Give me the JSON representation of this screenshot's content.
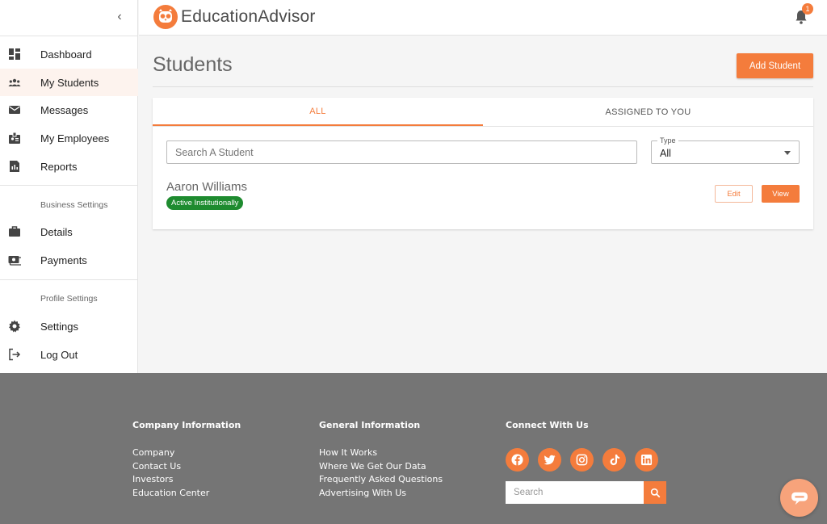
{
  "brand": {
    "name": "EducationAdvisor",
    "accent": "#f47c3c"
  },
  "sidebar": {
    "items": [
      {
        "label": "Dashboard",
        "icon": "dashboard-icon"
      },
      {
        "label": "My Students",
        "icon": "people-icon",
        "active": true
      },
      {
        "label": "Messages",
        "icon": "mail-icon"
      },
      {
        "label": "My Employees",
        "icon": "badge-icon"
      },
      {
        "label": "Reports",
        "icon": "report-icon"
      }
    ],
    "business_label": "Business Settings",
    "business_items": [
      {
        "label": "Details",
        "icon": "briefcase-icon"
      },
      {
        "label": "Payments",
        "icon": "payments-icon"
      }
    ],
    "profile_label": "Profile Settings",
    "profile_items": [
      {
        "label": "Settings",
        "icon": "gear-icon"
      },
      {
        "label": "Log Out",
        "icon": "logout-icon"
      }
    ]
  },
  "header": {
    "notification_count": "1"
  },
  "main": {
    "title": "Students",
    "add_label": "Add Student",
    "tabs": [
      {
        "label": "ALL",
        "active": true
      },
      {
        "label": "ASSIGNED TO YOU"
      }
    ],
    "search_placeholder": "Search A Student",
    "type_label": "Type",
    "type_value": "All",
    "student": {
      "name": "Aaron Williams",
      "status": "Active Institutionally",
      "status_color": "#1e8b2f",
      "edit_label": "Edit",
      "view_label": "View"
    }
  },
  "footer": {
    "company_title": "Company Information",
    "company_links": [
      "Company",
      "Contact Us",
      "Investors",
      "Education Center"
    ],
    "general_title": "General Information",
    "general_links": [
      "How It Works",
      "Where We Get Our Data",
      "Frequently Asked Questions",
      "Advertising With Us"
    ],
    "connect_title": "Connect With Us",
    "social": [
      "facebook-icon",
      "twitter-icon",
      "instagram-icon",
      "tiktok-icon",
      "linkedin-icon"
    ],
    "search_placeholder": "Search"
  }
}
